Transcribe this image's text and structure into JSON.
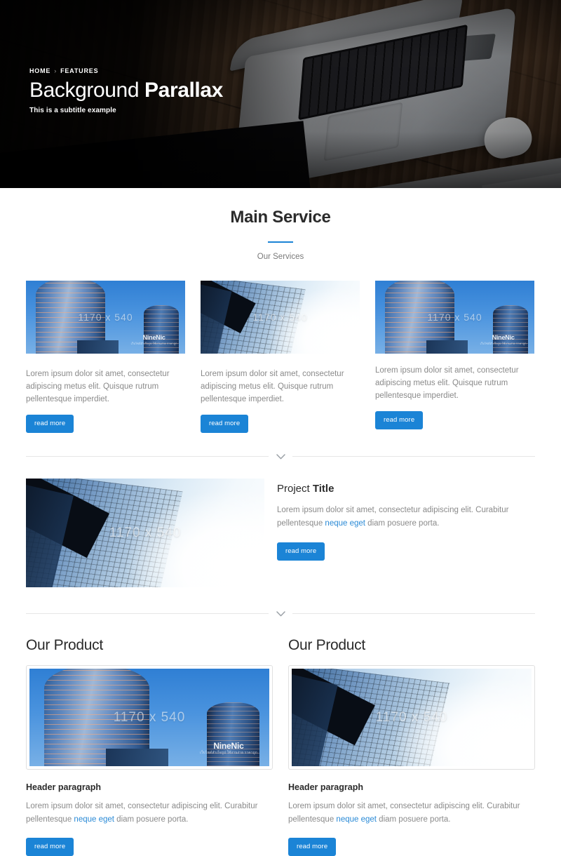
{
  "hero": {
    "breadcrumb": {
      "home": "HOME",
      "separator": "›",
      "current": "FEATURES"
    },
    "title_light": "Background ",
    "title_bold": "Parallax",
    "subtitle": "This is a subtitle example"
  },
  "services": {
    "title": "Main Service",
    "subtitle": "Our Services",
    "accent_color": "#1b84d6",
    "cards": [
      {
        "image_label": "1170 x 540",
        "watermark": "NineNic",
        "watermark_sub": "เว็บไซต์สำเร็จรูป ใช้งานง่าย ราคาถูก",
        "text": "Lorem ipsum dolor sit amet, consectetur adipiscing metus elit. Quisque rutrum pellentesque imperdiet.",
        "button": "read more"
      },
      {
        "image_label": "1170 x 540",
        "text": "Lorem ipsum dolor sit amet, consectetur adipiscing metus elit. Quisque rutrum pellentesque imperdiet.",
        "button": "read more"
      },
      {
        "image_label": "1170 x 540",
        "watermark": "NineNic",
        "watermark_sub": "เว็บไซต์สำเร็จรูป ใช้งานง่าย ราคาถูก",
        "text": "Lorem ipsum dolor sit amet, consectetur adipiscing metus elit. Quisque rutrum pellentesque imperdiet.",
        "button": "read more"
      }
    ]
  },
  "project": {
    "image_label": "1170 x 540",
    "title_light": "Project ",
    "title_bold": "Title",
    "text_before": "Lorem ipsum dolor sit amet, consectetur adipiscing elit. Curabitur pellentesque ",
    "link": "neque eget",
    "text_after": " diam posuere porta.",
    "button": "read more"
  },
  "products": [
    {
      "title": "Our Product",
      "image_label": "1170 x 540",
      "watermark": "NineNic",
      "watermark_sub": "เว็บไซต์สำเร็จรูป ใช้งานง่าย ราคาถูก",
      "heading": "Header paragraph",
      "text_before": "Lorem ipsum dolor sit amet, consectetur adipiscing elit. Curabitur pellentesque ",
      "link": "neque eget",
      "text_after": " diam posuere porta.",
      "button": "read more"
    },
    {
      "title": "Our Product",
      "image_label": "1170 x 540",
      "heading": "Header paragraph",
      "text_before": "Lorem ipsum dolor sit amet, consectetur adipiscing elit. Curabitur pellentesque ",
      "link": "neque eget",
      "text_after": " diam posuere porta.",
      "button": "read more"
    }
  ],
  "icons": {
    "chevron_down": "chevron-down-icon"
  }
}
